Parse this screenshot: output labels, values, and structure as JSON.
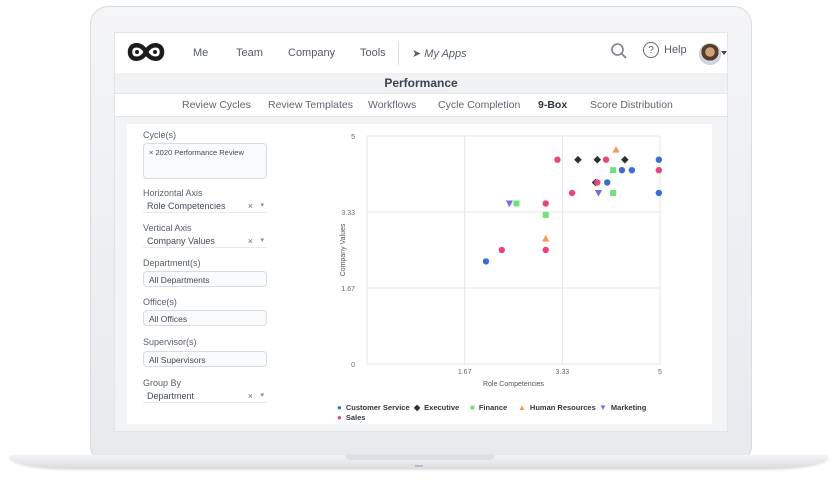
{
  "topnav": {
    "items": [
      "Me",
      "Team",
      "Company",
      "Tools"
    ],
    "my_apps": "My Apps",
    "help": "Help"
  },
  "page_title": "Performance",
  "tabs": [
    {
      "label": "Review Cycles",
      "active": false
    },
    {
      "label": "Review Templates",
      "active": false
    },
    {
      "label": "Workflows",
      "active": false
    },
    {
      "label": "Cycle Completion",
      "active": false
    },
    {
      "label": "9-Box",
      "active": true
    },
    {
      "label": "Score Distribution",
      "active": false
    }
  ],
  "filters": {
    "cycles_label": "Cycle(s)",
    "cycle_tag": "2020 Performance Review",
    "horizontal_label": "Horizontal Axis",
    "horizontal_value": "Role Competencies",
    "vertical_label": "Vertical Axis",
    "vertical_value": "Company Values",
    "department_label": "Department(s)",
    "department_value": "All Departments",
    "office_label": "Office(s)",
    "office_value": "All Offices",
    "supervisor_label": "Supervisor(s)",
    "supervisor_value": "All Supervisors",
    "groupby_label": "Group By",
    "groupby_value": "Department"
  },
  "chart_data": {
    "type": "scatter",
    "xlabel": "Role Competencies",
    "ylabel": "Company Values",
    "xlim": [
      0,
      5
    ],
    "ylim": [
      0,
      5
    ],
    "xticks": [
      "1.67",
      "3.33",
      "5"
    ],
    "yticks": [
      "5",
      "3.33",
      "1.67",
      "0"
    ],
    "grid": true,
    "legend_position": "bottom",
    "series": [
      {
        "name": "Customer Service",
        "color": "#3a6fcc",
        "marker": "circle",
        "points": [
          [
            2.03,
            2.25
          ],
          [
            4.1,
            3.98
          ],
          [
            4.35,
            4.25
          ],
          [
            4.52,
            4.25
          ],
          [
            4.98,
            4.48
          ],
          [
            4.98,
            3.75
          ]
        ]
      },
      {
        "name": "Executive",
        "color": "#2f2f2f",
        "marker": "diamond",
        "points": [
          [
            3.6,
            4.48
          ],
          [
            3.93,
            4.48
          ],
          [
            3.9,
            3.98
          ],
          [
            4.4,
            4.48
          ]
        ]
      },
      {
        "name": "Finance",
        "color": "#6fe07a",
        "marker": "square",
        "points": [
          [
            2.55,
            3.52
          ],
          [
            3.05,
            3.27
          ],
          [
            4.2,
            4.25
          ],
          [
            4.2,
            3.75
          ]
        ]
      },
      {
        "name": "Human Resources",
        "color": "#f29b54",
        "marker": "triangle",
        "points": [
          [
            3.05,
            2.75
          ],
          [
            4.25,
            4.7
          ]
        ]
      },
      {
        "name": "Marketing",
        "color": "#7b6fe0",
        "marker": "triangle-down",
        "points": [
          [
            2.43,
            3.52
          ],
          [
            3.95,
            3.75
          ]
        ]
      },
      {
        "name": "Sales",
        "color": "#e8467a",
        "marker": "circle",
        "points": [
          [
            2.3,
            2.5
          ],
          [
            3.05,
            3.52
          ],
          [
            3.05,
            2.5
          ],
          [
            3.25,
            4.48
          ],
          [
            3.5,
            3.75
          ],
          [
            3.93,
            3.98
          ],
          [
            4.08,
            4.48
          ],
          [
            4.98,
            4.25
          ]
        ]
      }
    ]
  },
  "icons": {
    "search": "search-icon",
    "help": "help-icon",
    "apps": "paper-plane-icon",
    "logo": "infinity-logo"
  }
}
